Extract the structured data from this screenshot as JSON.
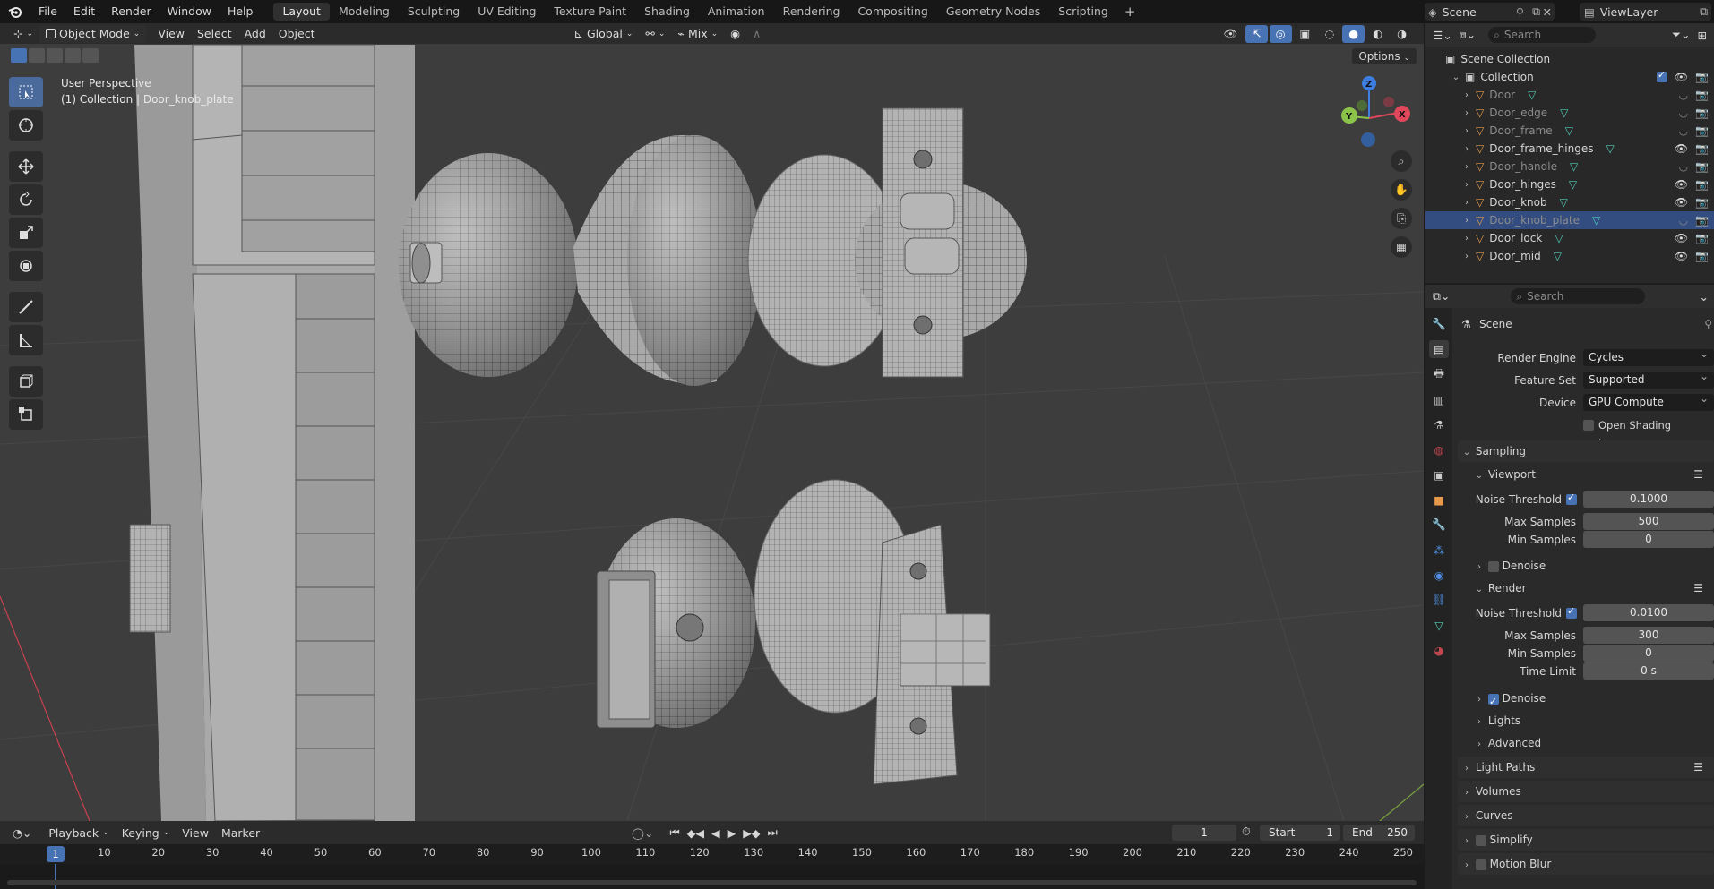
{
  "menu": [
    "File",
    "Edit",
    "Render",
    "Window",
    "Help"
  ],
  "workspaces": [
    "Layout",
    "Modeling",
    "Sculpting",
    "UV Editing",
    "Texture Paint",
    "Shading",
    "Animation",
    "Rendering",
    "Compositing",
    "Geometry Nodes",
    "Scripting"
  ],
  "active_workspace": "Layout",
  "scene_name": "Scene",
  "view_layer": "ViewLayer",
  "viewport": {
    "mode": "Object Mode",
    "menus": [
      "View",
      "Select",
      "Add",
      "Object"
    ],
    "orientation": "Global",
    "snap_mode": "Mix",
    "options_label": "Options",
    "title_line1": "User Perspective",
    "title_line2": "(1) Collection | Door_knob_plate",
    "gizmo_axes": {
      "x": "X",
      "y": "Y",
      "z": "Z"
    }
  },
  "outliner": {
    "search_placeholder": "Search",
    "scene_collection": "Scene Collection",
    "collection": "Collection",
    "objects": [
      {
        "name": "Door",
        "dim": true
      },
      {
        "name": "Door_edge",
        "dim": true
      },
      {
        "name": "Door_frame",
        "dim": true
      },
      {
        "name": "Door_frame_hinges",
        "dim": false
      },
      {
        "name": "Door_handle",
        "dim": true
      },
      {
        "name": "Door_hinges",
        "dim": false
      },
      {
        "name": "Door_knob",
        "dim": false
      },
      {
        "name": "Door_knob_plate",
        "dim": true,
        "selected": true
      },
      {
        "name": "Door_lock",
        "dim": false
      },
      {
        "name": "Door_mid",
        "dim": false
      }
    ]
  },
  "properties": {
    "search_placeholder": "Search",
    "context": "Scene",
    "render_engine_label": "Render Engine",
    "render_engine": "Cycles",
    "feature_set_label": "Feature Set",
    "feature_set": "Supported",
    "device_label": "Device",
    "device": "GPU Compute",
    "osl_label": "Open Shading Language",
    "sampling": "Sampling",
    "viewport_section": "Viewport",
    "noise_threshold_label": "Noise Threshold",
    "viewport_noise_threshold": "0.1000",
    "max_samples_label": "Max Samples",
    "viewport_max_samples": "500",
    "min_samples_label": "Min Samples",
    "viewport_min_samples": "0",
    "denoise_label": "Denoise",
    "render_section": "Render",
    "render_noise_threshold": "0.0100",
    "render_max_samples": "300",
    "render_min_samples": "0",
    "time_limit_label": "Time Limit",
    "time_limit": "0 s",
    "lights": "Lights",
    "advanced": "Advanced",
    "light_paths": "Light Paths",
    "volumes": "Volumes",
    "curves": "Curves",
    "simplify": "Simplify",
    "motion_blur": "Motion Blur"
  },
  "timeline": {
    "menus": [
      "Playback",
      "Keying",
      "View",
      "Marker"
    ],
    "current_frame": "1",
    "start_label": "Start",
    "start": "1",
    "end_label": "End",
    "end": "250",
    "ruler": [
      "1",
      "10",
      "20",
      "30",
      "40",
      "50",
      "60",
      "70",
      "80",
      "90",
      "100",
      "110",
      "120",
      "130",
      "140",
      "150",
      "160",
      "170",
      "180",
      "190",
      "200",
      "210",
      "220",
      "230",
      "240",
      "250"
    ]
  },
  "colors": {
    "accent": "#4772b3",
    "selection": "#334d80",
    "x_axis": "#e0475b",
    "y_axis": "#8bc34a",
    "z_axis": "#3d7ee0",
    "object_icon": "#e69a4b",
    "mesh_icon": "#4ecdb4"
  }
}
